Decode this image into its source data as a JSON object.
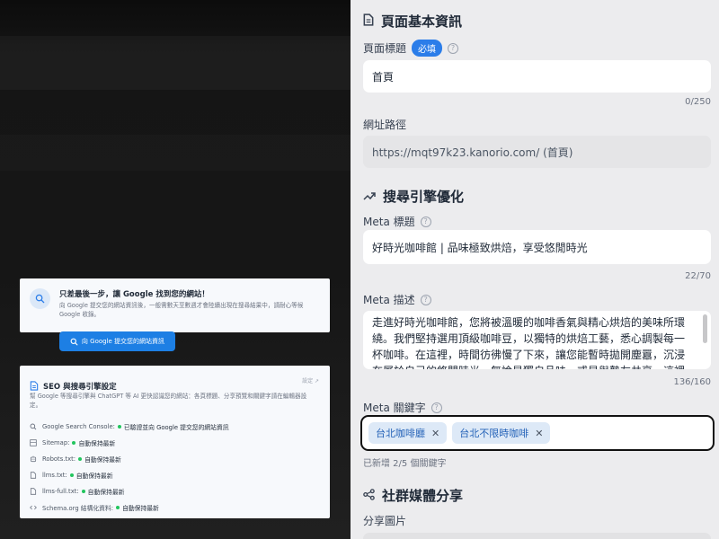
{
  "left": {
    "card1": {
      "title": "只差最後一步，讓 Google 找到您的網站！",
      "body": "向 Google 提交您的網站資訊後，一般需數天至數週才會陸續出現在搜尋結果中，請耐心等候 Google 收錄。",
      "button": "向 Google 提交您的網站資訊"
    },
    "card2": {
      "title": "SEO 與搜尋引擎設定",
      "settings": "設定 ↗",
      "description": "幫 Google 等搜尋引擎與 ChatGPT 等 AI 更快認識您的網站：各頁標題、分享預覽和關鍵字請在編輯器設定。",
      "items": [
        {
          "icon": "search-icon",
          "label": "Google Search Console:",
          "value": "已驗證並向 Google 提交您的網站資訊"
        },
        {
          "icon": "sitemap-icon",
          "label": "Sitemap:",
          "value": "自動保持最新"
        },
        {
          "icon": "robot-icon",
          "label": "Robots.txt:",
          "value": "自動保持最新"
        },
        {
          "icon": "file-icon",
          "label": "llms.txt:",
          "value": "自動保持最新"
        },
        {
          "icon": "file-icon",
          "label": "llms-full.txt:",
          "value": "自動保持最新"
        },
        {
          "icon": "code-icon",
          "label": "Schema.org 結構化資料:",
          "value": "自動保持最新"
        }
      ]
    }
  },
  "right": {
    "basic": {
      "heading": "頁面基本資訊",
      "title_label": "頁面標題",
      "required_badge": "必填",
      "title_value": "首頁",
      "title_counter": "0/250",
      "url_label": "網址路徑",
      "url_value": "https://mqt97k23.kanorio.com/ (首頁)"
    },
    "seo": {
      "heading": "搜尋引擎優化",
      "meta_title_label": "Meta 標題",
      "meta_title_value": "好時光咖啡館 | 品味極致烘焙，享受悠閒時光",
      "meta_title_counter": "22/70",
      "meta_desc_label": "Meta 描述",
      "meta_desc_value": "走進好時光咖啡館，您將被溫暖的咖啡香氣與精心烘焙的美味所環繞。我們堅持選用頂級咖啡豆，以獨特的烘焙工藝，悉心調製每一杯咖啡。在這裡，時間彷彿慢了下來，讓您能暫時拋開塵囂，沉浸在屬於自己的悠閒時光。無論是獨自品味，或是與摯友共享，這裡都是您",
      "meta_desc_counter": "136/160",
      "keywords_label": "Meta 關鍵字",
      "keywords": [
        "台北咖啡廳",
        "台北不限時咖啡"
      ],
      "keywords_hint": "已新增 2/5 個關鍵字"
    },
    "social": {
      "heading": "社群媒體分享",
      "share_image_label": "分享圖片"
    }
  },
  "colors": {
    "accent": "#2b7de9",
    "button": "#1d7fe4",
    "tag_bg": "#dde9f7",
    "status_ok": "#22c55e"
  }
}
